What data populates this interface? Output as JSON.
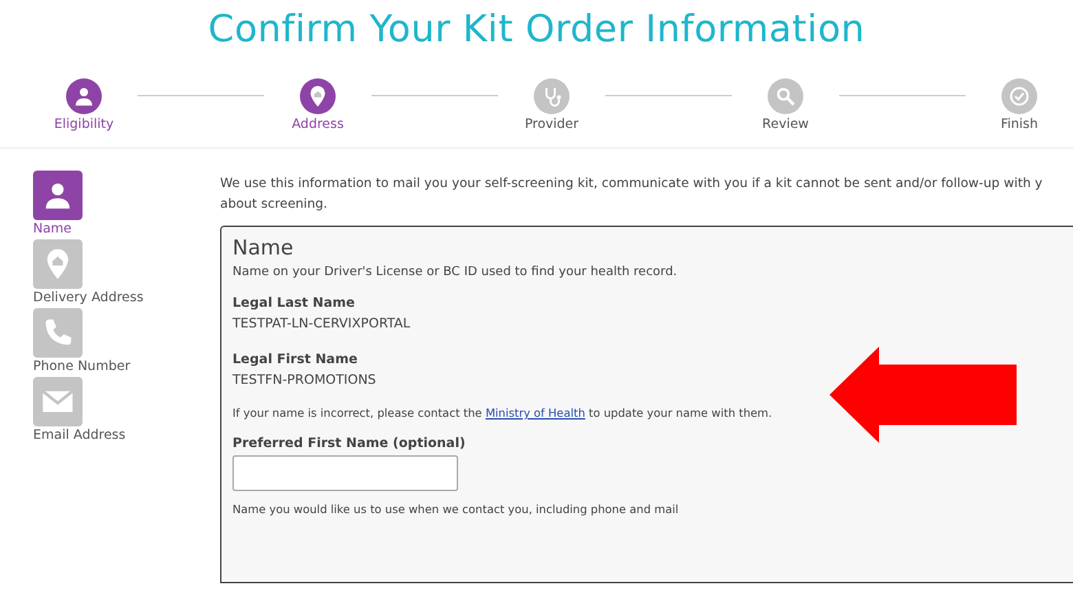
{
  "page_title": "Confirm Your Kit Order Information",
  "steps": [
    {
      "label": "Eligibility",
      "kind": "person",
      "active": true
    },
    {
      "label": "Address",
      "kind": "pin",
      "active": true
    },
    {
      "label": "Provider",
      "kind": "stethoscope",
      "active": false
    },
    {
      "label": "Review",
      "kind": "search",
      "active": false
    },
    {
      "label": "Finish",
      "kind": "check",
      "active": false
    }
  ],
  "sidebar": {
    "items": [
      {
        "label": "Name",
        "kind": "person",
        "selected": true
      },
      {
        "label": "Delivery Address",
        "kind": "pin",
        "selected": false
      },
      {
        "label": "Phone Number",
        "kind": "phone",
        "selected": false
      },
      {
        "label": "Email Address",
        "kind": "mail",
        "selected": false
      }
    ]
  },
  "intro": "We use this information to mail you your self-screening kit, communicate with you if a kit cannot be sent and/or follow-up with y about screening.",
  "card": {
    "title": "Name",
    "subtitle": "Name on your Driver's License or BC ID used to find your health record.",
    "fields": [
      {
        "label": "Legal Last Name",
        "value": "TESTPAT-LN-CERVIXPORTAL"
      },
      {
        "label": "Legal First Name",
        "value": "TESTFN-PROMOTIONS"
      }
    ],
    "note": {
      "before": "If your name is incorrect, please contact the ",
      "link": "Ministry of Health",
      "after": " to update your name with them."
    },
    "input": {
      "label": "Preferred First Name (optional)",
      "help": "Name you would like us to use when we contact you, including phone and mail"
    }
  },
  "annotation": {
    "kind": "arrow"
  }
}
